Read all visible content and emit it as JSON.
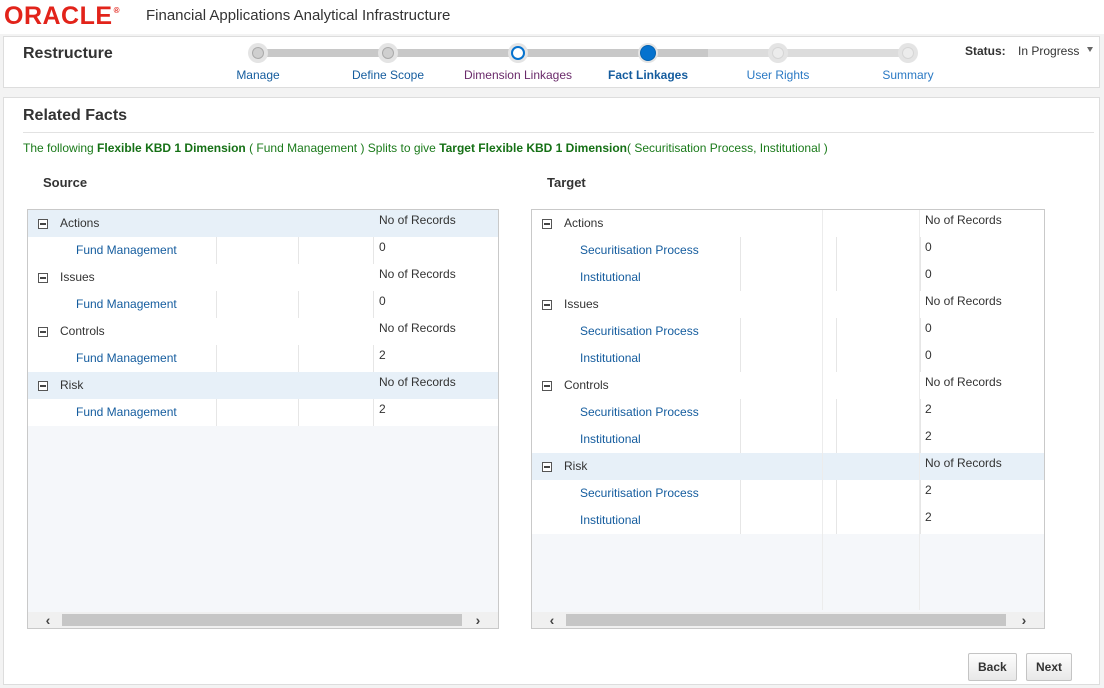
{
  "header": {
    "logo_text": "ORACLE",
    "logo_mark": "®",
    "app_title": "Financial Applications Analytical Infrastructure"
  },
  "train": {
    "title": "Restructure",
    "steps": [
      {
        "label": "Manage",
        "state": "visited"
      },
      {
        "label": "Define Scope",
        "state": "visited"
      },
      {
        "label": "Dimension Linkages",
        "state": "prev"
      },
      {
        "label": "Fact Linkages",
        "state": "current"
      },
      {
        "label": "User Rights",
        "state": "future"
      },
      {
        "label": "Summary",
        "state": "future"
      }
    ],
    "status_label": "Status:",
    "status_value": "In Progress"
  },
  "main": {
    "title": "Related Facts",
    "info": {
      "p1": "The following ",
      "dim": "Flexible KBD 1 Dimension",
      "p2": " ( Fund Management ) Splits to give ",
      "target": "Target Flexible KBD 1 Dimension",
      "p3": "( Securitisation Process, Institutional )"
    },
    "source_heading": "Source",
    "target_heading": "Target",
    "source_rows": [
      {
        "type": "parent",
        "label": "Actions",
        "value": "No of Records"
      },
      {
        "type": "child",
        "label": "Fund Management",
        "value": "0"
      },
      {
        "type": "parent",
        "label": "Issues",
        "value": "No of Records"
      },
      {
        "type": "child",
        "label": "Fund Management",
        "value": "0"
      },
      {
        "type": "parent",
        "label": "Controls",
        "value": "No of Records"
      },
      {
        "type": "child",
        "label": "Fund Management",
        "value": "2"
      },
      {
        "type": "parent",
        "label": "Risk",
        "value": "No of Records"
      },
      {
        "type": "child",
        "label": "Fund Management",
        "value": "2"
      }
    ],
    "target_rows": [
      {
        "type": "parent",
        "label": "Actions",
        "value": "No of Records"
      },
      {
        "type": "child",
        "label": "Securitisation Process",
        "value": "0"
      },
      {
        "type": "child",
        "label": "Institutional",
        "value": "0"
      },
      {
        "type": "parent",
        "label": "Issues",
        "value": "No of Records"
      },
      {
        "type": "child",
        "label": "Securitisation Process",
        "value": "0"
      },
      {
        "type": "child",
        "label": "Institutional",
        "value": "0"
      },
      {
        "type": "parent",
        "label": "Controls",
        "value": "No of Records"
      },
      {
        "type": "child",
        "label": "Securitisation Process",
        "value": "2"
      },
      {
        "type": "child",
        "label": "Institutional",
        "value": "2"
      },
      {
        "type": "parent",
        "label": "Risk",
        "value": "No of Records"
      },
      {
        "type": "child",
        "label": "Securitisation Process",
        "value": "2"
      },
      {
        "type": "child",
        "label": "Institutional",
        "value": "2"
      }
    ],
    "scroll_left": "‹",
    "scroll_right": "›",
    "back_label": "Back",
    "next_label": "Next"
  },
  "colors": {
    "oracle_red": "#e2231a",
    "accent_blue": "#0572ce",
    "info_green": "#1a7a1a",
    "link_blue": "#145c9e"
  }
}
